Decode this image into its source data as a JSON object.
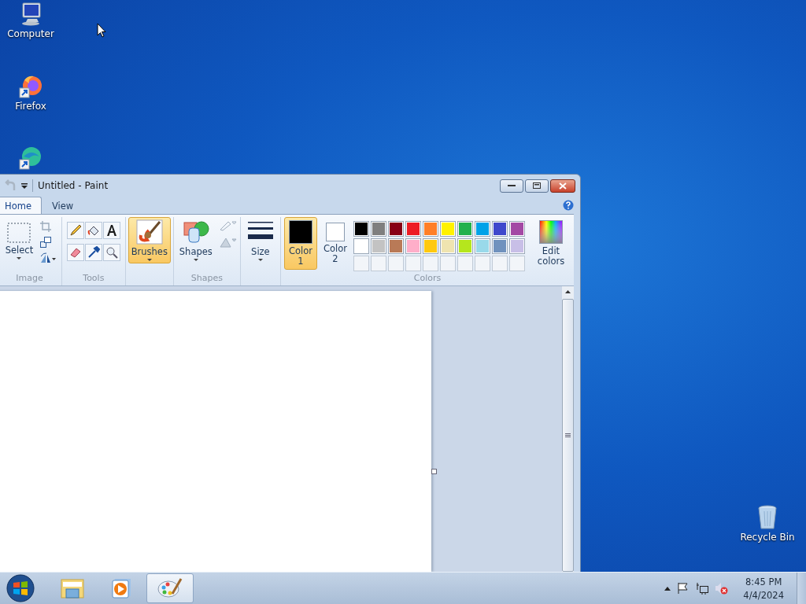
{
  "desktop_icons": [
    {
      "kind": "computer",
      "label": "Computer"
    },
    {
      "kind": "firefox",
      "label": "Firefox"
    },
    {
      "kind": "edge"
    }
  ],
  "recycle_bin": {
    "label": "Recycle Bin"
  },
  "window": {
    "title": "Untitled - Paint",
    "tabs": [
      {
        "label": "Home",
        "selected": true
      },
      {
        "label": "View",
        "selected": false
      }
    ],
    "ribbon": {
      "image": {
        "label": "Image",
        "select_label": "Select"
      },
      "tools": {
        "label": "Tools"
      },
      "brushes": {
        "label": "Brushes",
        "selected": true
      },
      "shapes": {
        "label": "Shapes",
        "button_label": "Shapes"
      },
      "size": {
        "label": "Size"
      },
      "colors": {
        "label": "Colors",
        "edit_label": "Edit colors",
        "color_slots": [
          {
            "label": "Color 1",
            "color": "#000000",
            "selected": true
          },
          {
            "label": "Color 2",
            "color": "#ffffff",
            "selected": false
          }
        ],
        "palette": [
          {
            "color": "#000000"
          },
          {
            "color": "#7f7f7f"
          },
          {
            "color": "#880015"
          },
          {
            "color": "#ed1c24"
          },
          {
            "color": "#ff7f27"
          },
          {
            "color": "#fff200"
          },
          {
            "color": "#22b14c"
          },
          {
            "color": "#00a2e8"
          },
          {
            "color": "#3f48cc"
          },
          {
            "color": "#a349a4"
          },
          {
            "color": "#ffffff"
          },
          {
            "color": "#c3c3c3"
          },
          {
            "color": "#b97a57"
          },
          {
            "color": "#ffaec9"
          },
          {
            "color": "#ffc90e"
          },
          {
            "color": "#efe4b0"
          },
          {
            "color": "#b5e61d"
          },
          {
            "color": "#99d9ea"
          },
          {
            "color": "#7092be"
          },
          {
            "color": "#c8bfe7"
          }
        ]
      }
    }
  },
  "taskbar": {
    "apps": [
      {
        "kind": "explorer",
        "selected": false
      },
      {
        "kind": "media",
        "selected": false
      },
      {
        "kind": "paint",
        "selected": true
      }
    ],
    "time": "8:45 PM",
    "date": "4/4/2024"
  }
}
